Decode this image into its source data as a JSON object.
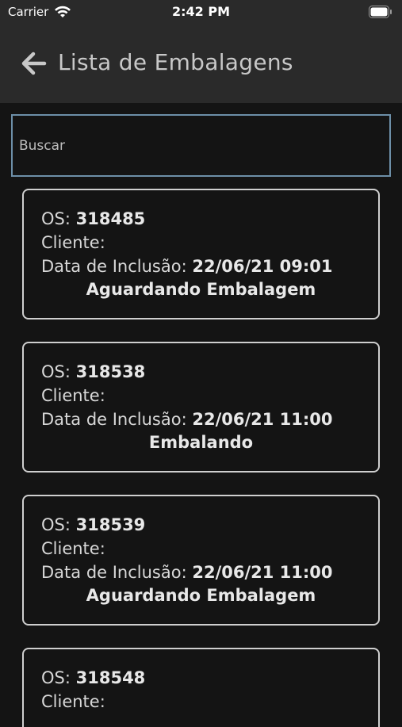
{
  "status_bar": {
    "carrier": "Carrier",
    "time": "2:42 PM"
  },
  "navbar": {
    "title": "Lista de Embalagens",
    "back_icon": "arrow-left-icon"
  },
  "search": {
    "placeholder": "Buscar",
    "value": ""
  },
  "labels": {
    "os": "OS:",
    "cliente": "Cliente:",
    "data_inclusao": "Data de Inclusão:"
  },
  "items": [
    {
      "os": "318485",
      "cliente": "",
      "data": "22/06/21 09:01",
      "status": "Aguardando Embalagem"
    },
    {
      "os": "318538",
      "cliente": "",
      "data": "22/06/21 11:00",
      "status": "Embalando"
    },
    {
      "os": "318539",
      "cliente": "",
      "data": "22/06/21 11:00",
      "status": "Aguardando Embalagem"
    },
    {
      "os": "318548",
      "cliente": "",
      "data": "",
      "status": ""
    }
  ],
  "colors": {
    "background": "#141414",
    "bar": "#2a2a2a",
    "search_border": "#6d8fa8",
    "card_border": "#cfcfcf"
  }
}
